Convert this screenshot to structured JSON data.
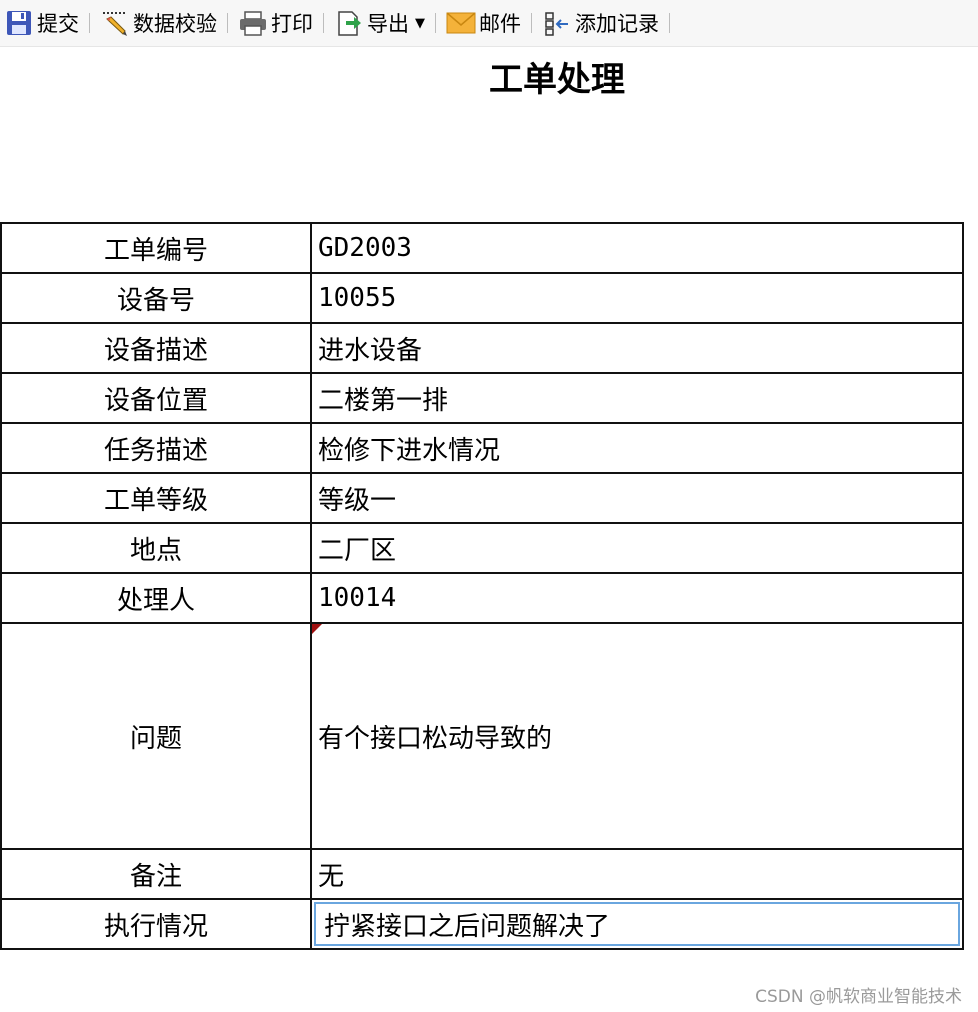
{
  "toolbar": {
    "submit": "提交",
    "validate": "数据校验",
    "print": "打印",
    "export": "导出",
    "mail": "邮件",
    "add_record": "添加记录"
  },
  "page_title": "工单处理",
  "fields": {
    "order_no": {
      "label": "工单编号",
      "value": "GD2003"
    },
    "equip_no": {
      "label": "设备号",
      "value": "10055"
    },
    "equip_desc": {
      "label": "设备描述",
      "value": "进水设备"
    },
    "equip_loc": {
      "label": "设备位置",
      "value": "二楼第一排"
    },
    "task_desc": {
      "label": "任务描述",
      "value": "检修下进水情况"
    },
    "level": {
      "label": "工单等级",
      "value": "等级一"
    },
    "site": {
      "label": "地点",
      "value": "二厂区"
    },
    "handler": {
      "label": "处理人",
      "value": "10014"
    },
    "issue": {
      "label": "问题",
      "value": "有个接口松动导致的"
    },
    "remark": {
      "label": "备注",
      "value": "无"
    },
    "execution": {
      "label": "执行情况",
      "value": "拧紧接口之后问题解决了"
    }
  },
  "watermark": "CSDN @帆软商业智能技术",
  "colors": {
    "input_border": "#6aa6df",
    "cell_flag": "#a01010"
  }
}
